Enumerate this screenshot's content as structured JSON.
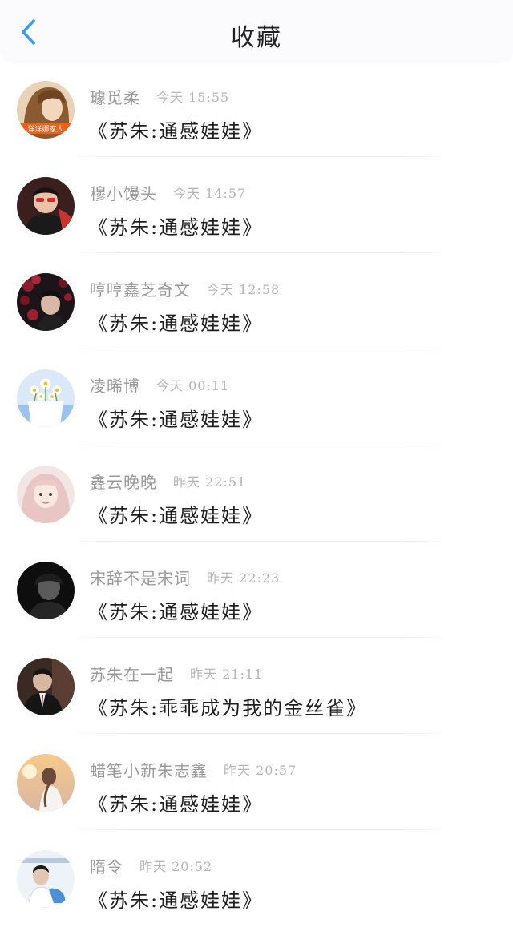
{
  "header": {
    "title": "收藏",
    "back_icon": "chevron-left-icon",
    "accent_color": "#3a9bf2"
  },
  "items": [
    {
      "username": "璩觅柔",
      "time": "今天 15:55",
      "snippet": "《苏朱:通感娃娃》",
      "avatar_note": "洋洋娜家人"
    },
    {
      "username": "穆小馒头",
      "time": "今天 14:57",
      "snippet": "《苏朱:通感娃娃》"
    },
    {
      "username": "哼哼鑫芝奇文",
      "time": "今天 12:58",
      "snippet": "《苏朱:通感娃娃》"
    },
    {
      "username": "凌晞博",
      "time": "今天 00:11",
      "snippet": "《苏朱:通感娃娃》"
    },
    {
      "username": "鑫云晚晚",
      "time": "昨天 22:51",
      "snippet": "《苏朱:通感娃娃》"
    },
    {
      "username": "宋辞不是宋词",
      "time": "昨天 22:23",
      "snippet": "《苏朱:通感娃娃》"
    },
    {
      "username": "苏朱在一起",
      "time": "昨天 21:11",
      "snippet": "《苏朱:乖乖成为我的金丝雀》"
    },
    {
      "username": "蜡笔小新朱志鑫",
      "time": "昨天 20:57",
      "snippet": "《苏朱:通感娃娃》"
    },
    {
      "username": "隋令",
      "time": "昨天 20:52",
      "snippet": "《苏朱:通感娃娃》"
    }
  ]
}
